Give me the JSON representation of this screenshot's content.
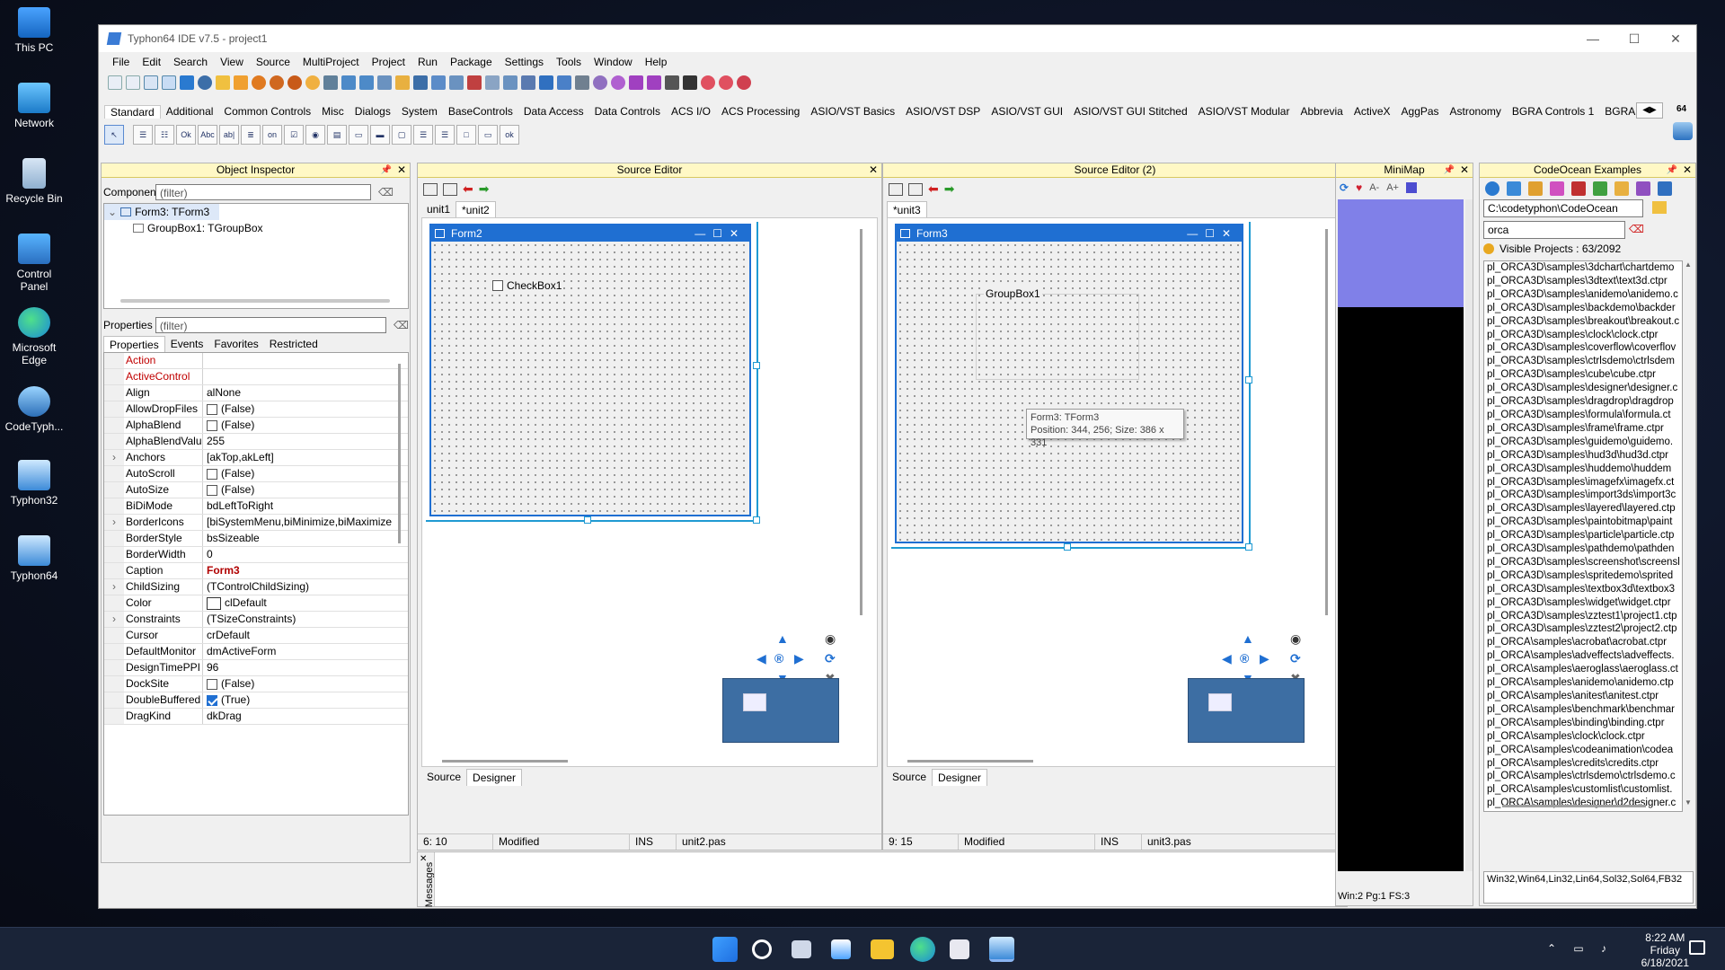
{
  "desktop": {
    "icons": [
      {
        "label": "This PC"
      },
      {
        "label": "Network"
      },
      {
        "label": "Recycle Bin"
      },
      {
        "label": "Control Panel"
      },
      {
        "label": "Microsoft Edge"
      },
      {
        "label": "CodeTyph..."
      },
      {
        "label": "Typhon32"
      },
      {
        "label": "Typhon64"
      }
    ]
  },
  "window": {
    "title": "Typhon64 IDE v7.5 - project1",
    "controls": {
      "minimize": "—",
      "maximize": "☐",
      "close": "✕"
    }
  },
  "menu": [
    "File",
    "Edit",
    "Search",
    "View",
    "Source",
    "MultiProject",
    "Project",
    "Run",
    "Package",
    "Settings",
    "Tools",
    "Window",
    "Help"
  ],
  "palette": {
    "tabs": [
      "Standard",
      "Additional",
      "Common Controls",
      "Misc",
      "Dialogs",
      "System",
      "BaseControls",
      "Data Access",
      "Data Controls",
      "ACS I/O",
      "ACS Processing",
      "ASIO/VST Basics",
      "ASIO/VST DSP",
      "ASIO/VST GUI",
      "ASIO/VST GUI Stitched",
      "ASIO/VST Modular",
      "Abbrevia",
      "ActiveX",
      "AggPas",
      "Astronomy",
      "BGRA Controls 1",
      "BGRA Controls"
    ],
    "badge": "64"
  },
  "object_inspector": {
    "title": "Object Inspector",
    "components_label": "Components",
    "components_filter": "(filter)",
    "tree": [
      "Form3: TForm3",
      "GroupBox1: TGroupBox"
    ],
    "properties_label": "Properties",
    "properties_filter": "(filter)",
    "tabs": [
      "Properties",
      "Events",
      "Favorites",
      "Restricted"
    ],
    "rows": [
      {
        "name": "Action",
        "value": "",
        "event": true
      },
      {
        "name": "ActiveControl",
        "value": "",
        "event": true
      },
      {
        "name": "Align",
        "value": "alNone"
      },
      {
        "name": "AllowDropFiles",
        "value": "(False)",
        "check": "off"
      },
      {
        "name": "AlphaBlend",
        "value": "(False)",
        "check": "off"
      },
      {
        "name": "AlphaBlendValu",
        "value": "255"
      },
      {
        "name": "Anchors",
        "value": "[akTop,akLeft]",
        "expand": true
      },
      {
        "name": "AutoScroll",
        "value": "(False)",
        "check": "off"
      },
      {
        "name": "AutoSize",
        "value": "(False)",
        "check": "off"
      },
      {
        "name": "BiDiMode",
        "value": "bdLeftToRight"
      },
      {
        "name": "BorderIcons",
        "value": "[biSystemMenu,biMinimize,biMaximize",
        "expand": true
      },
      {
        "name": "BorderStyle",
        "value": "bsSizeable"
      },
      {
        "name": "BorderWidth",
        "value": "0"
      },
      {
        "name": "Caption",
        "value": "Form3",
        "caption": true
      },
      {
        "name": "ChildSizing",
        "value": "(TControlChildSizing)",
        "expand": true
      },
      {
        "name": "Color",
        "value": "clDefault",
        "swatch": true
      },
      {
        "name": "Constraints",
        "value": "(TSizeConstraints)",
        "expand": true
      },
      {
        "name": "Cursor",
        "value": "crDefault"
      },
      {
        "name": "DefaultMonitor",
        "value": "dmActiveForm"
      },
      {
        "name": "DesignTimePPI",
        "value": "96"
      },
      {
        "name": "DockSite",
        "value": "(False)",
        "check": "off"
      },
      {
        "name": "DoubleBuffered",
        "value": "(True)",
        "check": "on"
      },
      {
        "name": "DragKind",
        "value": "dkDrag"
      }
    ]
  },
  "editor1": {
    "title": "Source Editor",
    "tabs": [
      "unit1",
      "*unit2"
    ],
    "form_caption": "Form2",
    "checkbox_label": "CheckBox1",
    "bottom_tabs": [
      "Source",
      "Designer"
    ],
    "status": {
      "pos": "6: 10",
      "state": "Modified",
      "mode": "INS",
      "file": "unit2.pas"
    }
  },
  "editor2": {
    "title": "Source Editor (2)",
    "tabs": [
      "*unit3"
    ],
    "form_caption": "Form3",
    "groupbox_label": "GroupBox1",
    "hint_line1": "Form3: TForm3",
    "hint_line2": "Position: 344, 256; Size: 386 x 331",
    "bottom_tabs": [
      "Source",
      "Designer"
    ],
    "status": {
      "pos": "9: 15",
      "state": "Modified",
      "mode": "INS",
      "file": "unit3.pas"
    }
  },
  "messages": {
    "label": "Messages"
  },
  "minimap": {
    "title": "MiniMap",
    "status": "Win:2 Pg:1  FS:3"
  },
  "codeocean": {
    "title": "CodeOcean Examples",
    "path": "C:\\codetyphon\\CodeOcean",
    "search": "orca",
    "visible": "Visible Projects : 63/2092",
    "items": [
      "pl_ORCA3D\\samples\\3dchart\\chartdemo",
      "pl_ORCA3D\\samples\\3dtext\\text3d.ctpr",
      "pl_ORCA3D\\samples\\anidemo\\anidemo.c",
      "pl_ORCA3D\\samples\\backdemo\\backder",
      "pl_ORCA3D\\samples\\breakout\\breakout.c",
      "pl_ORCA3D\\samples\\clock\\clock.ctpr",
      "pl_ORCA3D\\samples\\coverflow\\coverflov",
      "pl_ORCA3D\\samples\\ctrlsdemo\\ctrlsdem",
      "pl_ORCA3D\\samples\\cube\\cube.ctpr",
      "pl_ORCA3D\\samples\\designer\\designer.c",
      "pl_ORCA3D\\samples\\dragdrop\\dragdrop",
      "pl_ORCA3D\\samples\\formula\\formula.ct",
      "pl_ORCA3D\\samples\\frame\\frame.ctpr",
      "pl_ORCA3D\\samples\\guidemo\\guidemo.",
      "pl_ORCA3D\\samples\\hud3d\\hud3d.ctpr",
      "pl_ORCA3D\\samples\\huddemo\\huddem",
      "pl_ORCA3D\\samples\\imagefx\\imagefx.ct",
      "pl_ORCA3D\\samples\\import3ds\\import3c",
      "pl_ORCA3D\\samples\\layered\\layered.ctp",
      "pl_ORCA3D\\samples\\paintobitmap\\paint",
      "pl_ORCA3D\\samples\\particle\\particle.ctp",
      "pl_ORCA3D\\samples\\pathdemo\\pathden",
      "pl_ORCA3D\\samples\\screenshot\\screensl",
      "pl_ORCA3D\\samples\\spritedemo\\sprited",
      "pl_ORCA3D\\samples\\textbox3d\\textbox3",
      "pl_ORCA3D\\samples\\widget\\widget.ctpr",
      "pl_ORCA3D\\samples\\zztest1\\project1.ctp",
      "pl_ORCA3D\\samples\\zztest2\\project2.ctp",
      "pl_ORCA\\samples\\acrobat\\acrobat.ctpr",
      "pl_ORCA\\samples\\adveffects\\adveffects.",
      "pl_ORCA\\samples\\aeroglass\\aeroglass.ct",
      "pl_ORCA\\samples\\anidemo\\anidemo.ctp",
      "pl_ORCA\\samples\\anitest\\anitest.ctpr",
      "pl_ORCA\\samples\\benchmark\\benchmar",
      "pl_ORCA\\samples\\binding\\binding.ctpr",
      "pl_ORCA\\samples\\clock\\clock.ctpr",
      "pl_ORCA\\samples\\codeanimation\\codea",
      "pl_ORCA\\samples\\credits\\credits.ctpr",
      "pl_ORCA\\samples\\ctrlsdemo\\ctrlsdemo.c",
      "pl_ORCA\\samples\\customlist\\customlist.",
      "pl_ORCA\\samples\\designer\\d2designer.c"
    ],
    "platforms": "Win32,Win64,Lin32,Lin64,Sol32,Sol64,FB32"
  },
  "taskbar": {
    "time": "8:22 AM",
    "day": "Friday",
    "date": "6/18/2021"
  }
}
